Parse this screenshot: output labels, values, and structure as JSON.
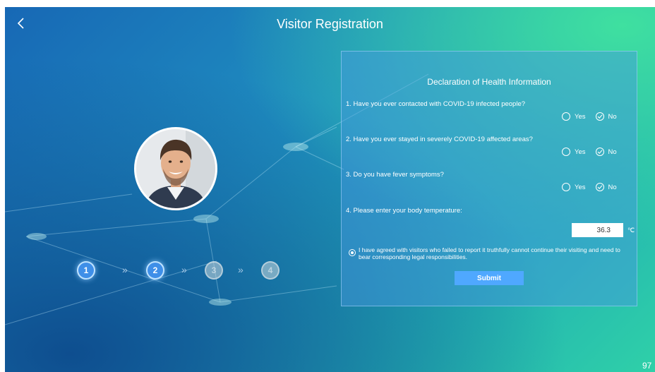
{
  "header": {
    "title": "Visitor Registration",
    "back_icon": "chevron-left-icon"
  },
  "visitor": {
    "avatar": "visitor-photo"
  },
  "steps": [
    {
      "label": "1",
      "state": "active"
    },
    {
      "label": "2",
      "state": "active"
    },
    {
      "label": "3",
      "state": "inactive"
    },
    {
      "label": "4",
      "state": "inactive"
    }
  ],
  "steps_separator": "»",
  "form": {
    "title": "Declaration of Health Information",
    "questions": [
      {
        "text": "1. Have you ever contacted with COVID-19 infected people?",
        "yes": "Yes",
        "no": "No",
        "selected": "No"
      },
      {
        "text": "2. Have you ever stayed in severely COVID-19 affected areas?",
        "yes": "Yes",
        "no": "No",
        "selected": "No"
      },
      {
        "text": "3. Do you have fever symptoms?",
        "yes": "Yes",
        "no": "No",
        "selected": "No"
      }
    ],
    "temperature": {
      "label": "4. Please enter your body temperature:",
      "value": "36.3",
      "unit": "℃"
    },
    "agreement": {
      "text": "I have agreed with visitors who failed to report it truthfully cannot continue their visiting and need to bear corresponding legal responsibilities.",
      "checked": true
    },
    "submit_label": "Submit"
  },
  "corner_text": "97",
  "colors": {
    "accent": "#4fa8ff",
    "panel": "#4696e1",
    "text": "#ffffff"
  }
}
